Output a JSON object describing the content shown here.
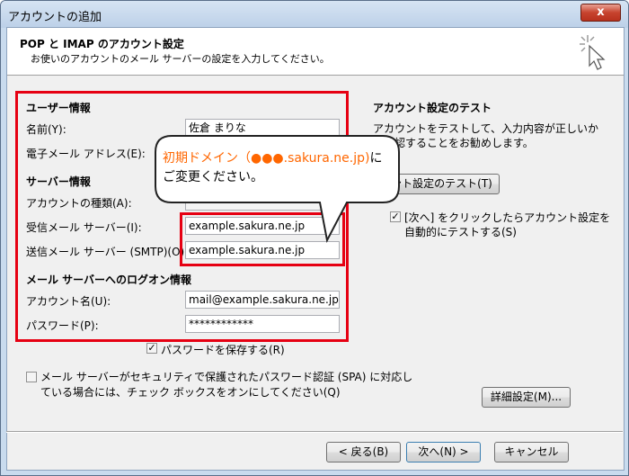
{
  "window": {
    "title": "アカウントの追加",
    "close_label": "x"
  },
  "header": {
    "title": "POP と IMAP のアカウント設定",
    "subtitle": "お使いのアカウントのメール サーバーの設定を入力してください。"
  },
  "user_info": {
    "section": "ユーザー情報",
    "name_label": "名前(Y):",
    "name_value": "佐倉 まりな",
    "email_label": "電子メール アドレス(E):"
  },
  "server_info": {
    "section": "サーバー情報",
    "account_type_label": "アカウントの種類(A):",
    "incoming_label": "受信メール サーバー(I):",
    "incoming_value": "example.sakura.ne.jp",
    "outgoing_label": "送信メール サーバー (SMTP)(O):",
    "outgoing_value": "example.sakura.ne.jp"
  },
  "logon_info": {
    "section": "メール サーバーへのログオン情報",
    "account_label": "アカウント名(U):",
    "account_value": "mail@example.sakura.ne.jp",
    "password_label": "パスワード(P):",
    "password_value": "************",
    "remember_label": "パスワードを保存する(R)"
  },
  "spa": {
    "line1": "メール サーバーがセキュリティで保護されたパスワード認証 (SPA) に対応し",
    "line2": "ている場合には、チェック ボックスをオンにしてください(Q)"
  },
  "test": {
    "section": "アカウント設定のテスト",
    "desc_line1": "アカウントをテストして、入力内容が正しいか",
    "desc_line2": "を確認することをお勧めします。",
    "test_button": "ウント設定のテスト(T)",
    "auto_line1": "[次へ] をクリックしたらアカウント設定を",
    "auto_line2": "自動的にテストする(S)"
  },
  "buttons": {
    "advanced": "詳細設定(M)...",
    "back": "< 戻る(B)",
    "next": "次へ(N) >",
    "cancel": "キャンセル"
  },
  "callout": {
    "highlight": "初期ドメイン（●●●.sakura.ne.jp)",
    "suffix": "に",
    "line2": "ご変更ください。"
  },
  "colors": {
    "highlight_border": "#e60012",
    "callout_text": "#ff6600"
  }
}
